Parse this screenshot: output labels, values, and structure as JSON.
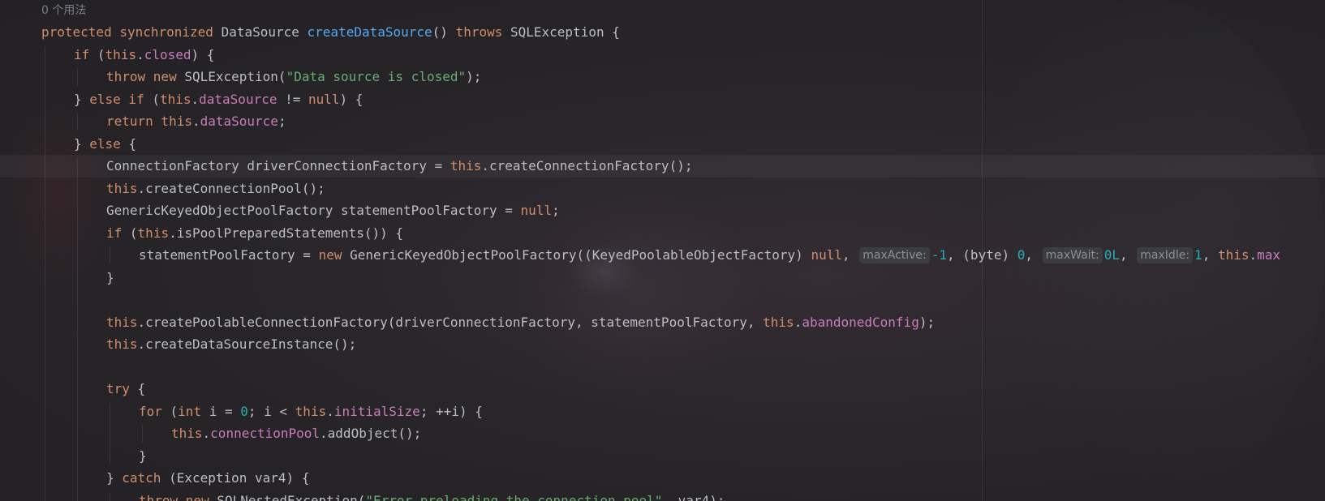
{
  "editor": {
    "usages_hint": "0 个用法",
    "lines": [
      {
        "indent": 0,
        "tokens": [
          {
            "t": "protected synchronized ",
            "c": "kw"
          },
          {
            "t": "DataSource "
          },
          {
            "t": "createDataSource",
            "c": "fn"
          },
          {
            "t": "() "
          },
          {
            "t": "throws ",
            "c": "kw"
          },
          {
            "t": "SQLException {"
          }
        ]
      },
      {
        "indent": 1,
        "tokens": [
          {
            "t": "if ",
            "c": "kw"
          },
          {
            "t": "("
          },
          {
            "t": "this",
            "c": "kw"
          },
          {
            "t": "."
          },
          {
            "t": "closed",
            "c": "fld"
          },
          {
            "t": ") {"
          }
        ]
      },
      {
        "indent": 2,
        "tokens": [
          {
            "t": "throw new ",
            "c": "kw"
          },
          {
            "t": "SQLException("
          },
          {
            "t": "\"Data source is closed\"",
            "c": "str"
          },
          {
            "t": ");"
          }
        ]
      },
      {
        "indent": 1,
        "tokens": [
          {
            "t": "} "
          },
          {
            "t": "else if ",
            "c": "kw"
          },
          {
            "t": "("
          },
          {
            "t": "this",
            "c": "kw"
          },
          {
            "t": "."
          },
          {
            "t": "dataSource",
            "c": "fld"
          },
          {
            "t": " != "
          },
          {
            "t": "null",
            "c": "kw"
          },
          {
            "t": ") {"
          }
        ]
      },
      {
        "indent": 2,
        "tokens": [
          {
            "t": "return this",
            "c": "kw"
          },
          {
            "t": "."
          },
          {
            "t": "dataSource",
            "c": "fld"
          },
          {
            "t": ";"
          }
        ]
      },
      {
        "indent": 1,
        "tokens": [
          {
            "t": "} "
          },
          {
            "t": "else ",
            "c": "kw"
          },
          {
            "t": "{"
          }
        ]
      },
      {
        "indent": 2,
        "current": true,
        "tokens": [
          {
            "t": "ConnectionFactory driverConnectionFactory = "
          },
          {
            "t": "this",
            "c": "kw"
          },
          {
            "t": ".createConnectionFactory();"
          }
        ]
      },
      {
        "indent": 2,
        "tokens": [
          {
            "t": "this",
            "c": "kw"
          },
          {
            "t": ".createConnectionPool();"
          }
        ]
      },
      {
        "indent": 2,
        "tokens": [
          {
            "t": "GenericKeyedObjectPoolFactory statementPoolFactory = "
          },
          {
            "t": "null",
            "c": "kw"
          },
          {
            "t": ";"
          }
        ]
      },
      {
        "indent": 2,
        "tokens": [
          {
            "t": "if ",
            "c": "kw"
          },
          {
            "t": "("
          },
          {
            "t": "this",
            "c": "kw"
          },
          {
            "t": ".isPoolPreparedStatements()) {"
          }
        ]
      },
      {
        "indent": 3,
        "tokens": [
          {
            "t": "statementPoolFactory = "
          },
          {
            "t": "new ",
            "c": "kw"
          },
          {
            "t": "GenericKeyedObjectPoolFactory((KeyedPoolableObjectFactory) "
          },
          {
            "t": "null",
            "c": "kw"
          },
          {
            "t": ", "
          },
          {
            "t": "maxActive:",
            "c": "hint"
          },
          {
            "t": "-1",
            "c": "num"
          },
          {
            "t": ", (byte) "
          },
          {
            "t": "0",
            "c": "num"
          },
          {
            "t": ", "
          },
          {
            "t": "maxWait:",
            "c": "hint"
          },
          {
            "t": "0L",
            "c": "num"
          },
          {
            "t": ", "
          },
          {
            "t": "maxIdle:",
            "c": "hint"
          },
          {
            "t": "1",
            "c": "num"
          },
          {
            "t": ", "
          },
          {
            "t": "this",
            "c": "kw"
          },
          {
            "t": "."
          },
          {
            "t": "max",
            "c": "fld"
          }
        ]
      },
      {
        "indent": 2,
        "tokens": [
          {
            "t": "}"
          }
        ]
      },
      {
        "indent": 0,
        "tokens": []
      },
      {
        "indent": 2,
        "tokens": [
          {
            "t": "this",
            "c": "kw"
          },
          {
            "t": ".createPoolableConnectionFactory(driverConnectionFactory, statementPoolFactory, "
          },
          {
            "t": "this",
            "c": "kw"
          },
          {
            "t": "."
          },
          {
            "t": "abandonedConfig",
            "c": "fld"
          },
          {
            "t": ");"
          }
        ]
      },
      {
        "indent": 2,
        "tokens": [
          {
            "t": "this",
            "c": "kw"
          },
          {
            "t": ".createDataSourceInstance();"
          }
        ]
      },
      {
        "indent": 0,
        "tokens": []
      },
      {
        "indent": 2,
        "tokens": [
          {
            "t": "try ",
            "c": "kw"
          },
          {
            "t": "{"
          }
        ]
      },
      {
        "indent": 3,
        "tokens": [
          {
            "t": "for ",
            "c": "kw"
          },
          {
            "t": "("
          },
          {
            "t": "int ",
            "c": "kw"
          },
          {
            "t": "i = "
          },
          {
            "t": "0",
            "c": "num"
          },
          {
            "t": "; i < "
          },
          {
            "t": "this",
            "c": "kw"
          },
          {
            "t": "."
          },
          {
            "t": "initialSize",
            "c": "fld"
          },
          {
            "t": "; ++i) {"
          }
        ]
      },
      {
        "indent": 4,
        "tokens": [
          {
            "t": "this",
            "c": "kw"
          },
          {
            "t": "."
          },
          {
            "t": "connectionPool",
            "c": "fld"
          },
          {
            "t": ".addObject();"
          }
        ]
      },
      {
        "indent": 3,
        "tokens": [
          {
            "t": "}"
          }
        ]
      },
      {
        "indent": 2,
        "tokens": [
          {
            "t": "} "
          },
          {
            "t": "catch ",
            "c": "kw"
          },
          {
            "t": "(Exception var4) {"
          }
        ]
      },
      {
        "indent": 3,
        "tokens": [
          {
            "t": "throw new ",
            "c": "kw"
          },
          {
            "t": "SQLNestedException("
          },
          {
            "t": "\"Error preloading the connection pool\"",
            "c": "str"
          },
          {
            "t": ", var4);"
          }
        ]
      }
    ]
  }
}
